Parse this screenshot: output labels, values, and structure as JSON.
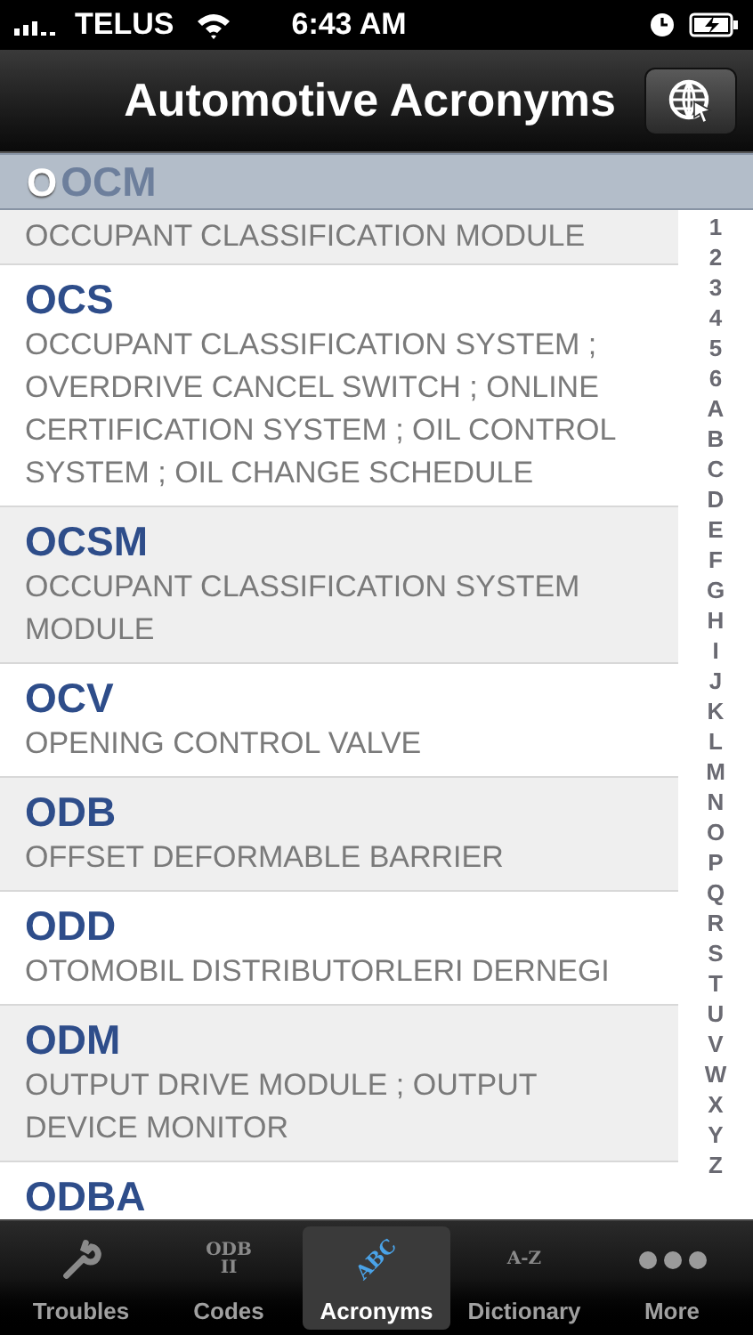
{
  "status_bar": {
    "carrier": "TELUS",
    "time": "6:43 AM"
  },
  "nav_bar": {
    "title": "Automotive Acronyms"
  },
  "section_header": "O",
  "rows": [
    {
      "acronym": "OCM",
      "meaning": "OCCUPANT CLASSIFICATION MODULE"
    },
    {
      "acronym": "OCS",
      "meaning": "OCCUPANT CLASSIFICATION SYSTEM ; OVERDRIVE CANCEL SWITCH ; ONLINE CERTIFICATION SYSTEM ; OIL CONTROL SYSTEM ; OIL CHANGE SCHEDULE"
    },
    {
      "acronym": "OCSM",
      "meaning": "OCCUPANT CLASSIFICATION SYSTEM MODULE"
    },
    {
      "acronym": "OCV",
      "meaning": "OPENING CONTROL VALVE"
    },
    {
      "acronym": "ODB",
      "meaning": "OFFSET DEFORMABLE BARRIER"
    },
    {
      "acronym": "ODD",
      "meaning": "OTOMOBIL DISTRIBUTORLERI DERNEGI"
    },
    {
      "acronym": "ODM",
      "meaning": "OUTPUT DRIVE MODULE ; OUTPUT DEVICE MONITOR"
    },
    {
      "acronym": "ODBA"
    }
  ],
  "index": [
    "1",
    "2",
    "3",
    "4",
    "5",
    "6",
    "A",
    "B",
    "C",
    "D",
    "E",
    "F",
    "G",
    "H",
    "I",
    "J",
    "K",
    "L",
    "M",
    "N",
    "O",
    "P",
    "Q",
    "R",
    "S",
    "T",
    "U",
    "V",
    "W",
    "X",
    "Y",
    "Z"
  ],
  "tabs": [
    {
      "label": "Troubles",
      "kind": "wrench",
      "selected": false
    },
    {
      "label": "Codes",
      "kind": "text",
      "icon_text": "ODB II",
      "selected": false
    },
    {
      "label": "Acronyms",
      "kind": "abc",
      "icon_text": "ABC",
      "selected": true
    },
    {
      "label": "Dictionary",
      "kind": "text",
      "icon_text": "A-Z",
      "selected": false
    },
    {
      "label": "More",
      "kind": "dots",
      "selected": false
    }
  ]
}
